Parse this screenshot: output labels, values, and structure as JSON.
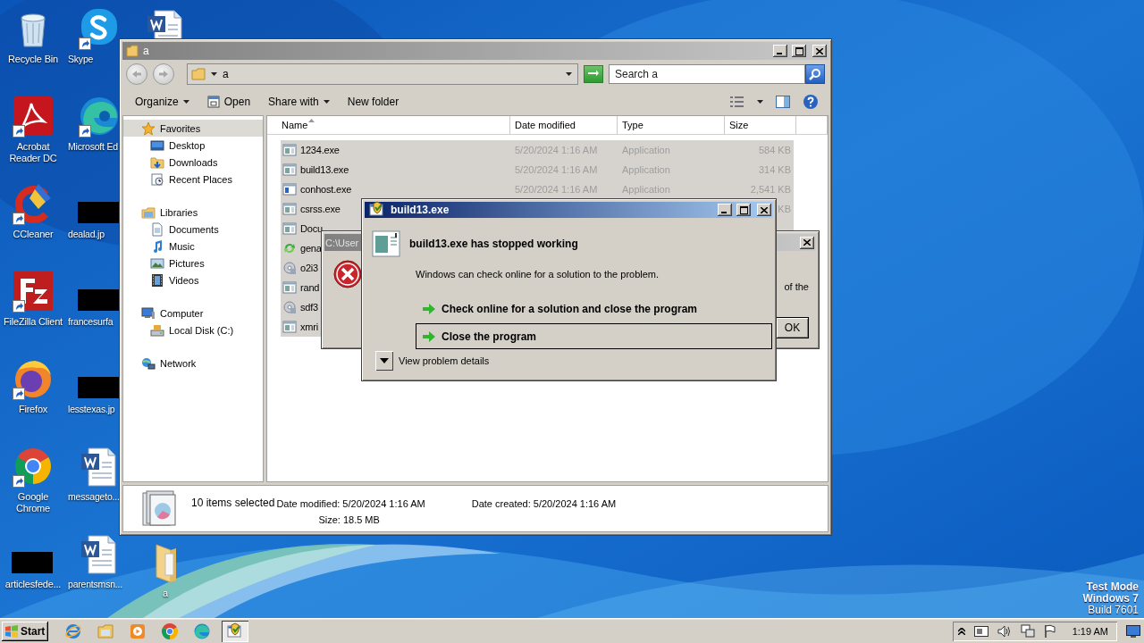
{
  "desktop": {
    "icon_columns": [
      [
        {
          "kind": "recycle-bin",
          "label": "Recycle Bin",
          "shortcut": false
        },
        {
          "kind": "acrobat",
          "label": "Acrobat Reader DC",
          "shortcut": true
        },
        {
          "kind": "ccleaner",
          "label": "CCleaner",
          "shortcut": true
        },
        {
          "kind": "filezilla",
          "label": "FileZilla Client",
          "shortcut": true
        },
        {
          "kind": "firefox",
          "label": "Firefox",
          "shortcut": true
        },
        {
          "kind": "chrome",
          "label": "Google Chrome",
          "shortcut": true
        },
        {
          "kind": "thumbnail",
          "label": "articlesfede...",
          "shortcut": false
        }
      ],
      [
        {
          "kind": "skype",
          "label": "Skype",
          "shortcut": true
        },
        {
          "kind": "edge",
          "label": "Microsoft Ed",
          "shortcut": true
        },
        {
          "kind": "thumbnail",
          "label": "dealad.jp",
          "shortcut": false
        },
        {
          "kind": "thumbnail",
          "label": "francesurfa",
          "shortcut": false
        },
        {
          "kind": "thumbnail",
          "label": "lesstexas.jp",
          "shortcut": false
        },
        {
          "kind": "word",
          "label": "messageto...",
          "shortcut": false
        },
        {
          "kind": "word",
          "label": "parentsmsn...",
          "shortcut": false
        }
      ],
      [
        {
          "kind": "word",
          "shortcut": false
        },
        {
          "kind": "folder",
          "label": "a",
          "shortcut": false
        }
      ]
    ],
    "os_notice": [
      {
        "text": "Test Mode",
        "bold": true
      },
      {
        "text": "Windows 7",
        "bold": true
      },
      {
        "text": "Build 7601",
        "bold": false
      }
    ]
  },
  "explorer": {
    "title": "a",
    "address": "a",
    "search": {
      "placeholder": "Search a"
    },
    "toolbar": [
      {
        "label": "Organize",
        "kind": "menu"
      },
      {
        "label": "Open",
        "kind": "icon"
      },
      {
        "label": "Share with",
        "kind": "menu"
      },
      {
        "label": "New folder",
        "kind": "plain"
      }
    ],
    "nav": [
      {
        "label": "Favorites",
        "kind": "star",
        "selected": true,
        "children": [
          {
            "label": "Desktop",
            "kind": "desktop",
            "selected": false
          },
          {
            "label": "Downloads",
            "kind": "downloads",
            "selected": false
          },
          {
            "label": "Recent Places",
            "kind": "recent",
            "selected": false
          }
        ]
      },
      {
        "label": "Libraries",
        "kind": "libraries",
        "selected": false,
        "children": [
          {
            "label": "Documents",
            "kind": "documents",
            "selected": false
          },
          {
            "label": "Music",
            "kind": "music",
            "selected": false
          },
          {
            "label": "Pictures",
            "kind": "pictures",
            "selected": false
          },
          {
            "label": "Videos",
            "kind": "videos",
            "selected": false
          }
        ]
      },
      {
        "label": "Computer",
        "kind": "computer",
        "selected": false,
        "children": [
          {
            "label": "Local Disk (C:)",
            "kind": "disk",
            "selected": false
          }
        ]
      },
      {
        "label": "Network",
        "kind": "network",
        "selected": false
      }
    ],
    "columns": [
      {
        "label": "Name",
        "sorted": true
      },
      {
        "label": "Date modified",
        "sorted": false
      },
      {
        "label": "Type",
        "sorted": false
      },
      {
        "label": "Size",
        "sorted": false
      }
    ],
    "files": [
      {
        "name": "1234.exe",
        "kind": "app",
        "date_modified": "5/20/2024 1:16 AM",
        "type": "Application",
        "size": "584 KB",
        "selected": true
      },
      {
        "name": "build13.exe",
        "kind": "app",
        "date_modified": "5/20/2024 1:16 AM",
        "type": "Application",
        "size": "314 KB",
        "selected": true
      },
      {
        "name": "conhost.exe",
        "kind": "console",
        "date_modified": "5/20/2024 1:16 AM",
        "type": "Application",
        "size": "2,541 KB",
        "selected": true
      },
      {
        "name": "csrss.exe",
        "kind": "app",
        "size": "KB",
        "selected": true
      },
      {
        "name": "Docu",
        "kind": "app",
        "selected": true
      },
      {
        "name": "gena",
        "kind": "refresh",
        "selected": true
      },
      {
        "name": "o2i3",
        "kind": "setup",
        "selected": true
      },
      {
        "name": "rand",
        "kind": "app",
        "selected": true
      },
      {
        "name": "sdf3",
        "kind": "setup",
        "selected": true
      },
      {
        "name": "xmri",
        "kind": "app",
        "selected": true
      }
    ],
    "details": {
      "count": "10 items selected",
      "date_modified": "Date modified: 5/20/2024 1:16 AM",
      "size": "Size: 18.5 MB",
      "date_created": "Date created: 5/20/2024 1:16 AM"
    }
  },
  "back_dialog": {
    "title": "C:\\User",
    "message_fragment": "of the",
    "button": "OK"
  },
  "error_dialog": {
    "title": "build13.exe",
    "heading": "build13.exe has stopped working",
    "message": "Windows can check online for a solution to the problem.",
    "options": [
      {
        "label": "Check online for a solution and close the program",
        "selected": false
      },
      {
        "label": "Close the program",
        "selected": true
      }
    ],
    "details_toggle": {
      "label": "View problem details",
      "expanded": false
    }
  },
  "taskbar": {
    "start": "Start",
    "apps": [
      {
        "kind": "ie",
        "selected": false
      },
      {
        "kind": "explorer",
        "selected": false
      },
      {
        "kind": "media",
        "selected": false
      },
      {
        "kind": "chrome",
        "selected": false
      },
      {
        "kind": "edge",
        "selected": false
      },
      {
        "kind": "error-report",
        "selected": true
      }
    ],
    "clock": "1:19 AM"
  }
}
